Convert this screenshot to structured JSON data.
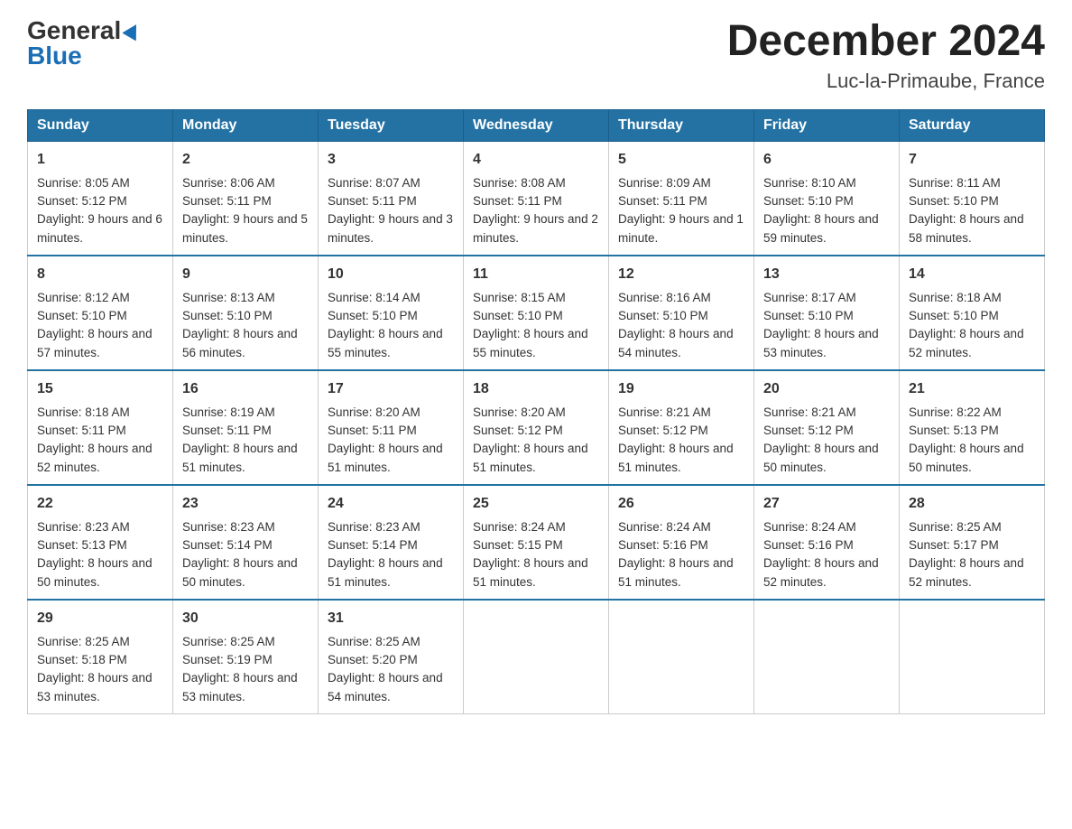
{
  "header": {
    "logo_general": "General",
    "logo_blue": "Blue",
    "month_title": "December 2024",
    "location": "Luc-la-Primaube, France"
  },
  "days_of_week": [
    "Sunday",
    "Monday",
    "Tuesday",
    "Wednesday",
    "Thursday",
    "Friday",
    "Saturday"
  ],
  "weeks": [
    [
      {
        "day": "1",
        "sunrise": "8:05 AM",
        "sunset": "5:12 PM",
        "daylight": "9 hours and 6 minutes."
      },
      {
        "day": "2",
        "sunrise": "8:06 AM",
        "sunset": "5:11 PM",
        "daylight": "9 hours and 5 minutes."
      },
      {
        "day": "3",
        "sunrise": "8:07 AM",
        "sunset": "5:11 PM",
        "daylight": "9 hours and 3 minutes."
      },
      {
        "day": "4",
        "sunrise": "8:08 AM",
        "sunset": "5:11 PM",
        "daylight": "9 hours and 2 minutes."
      },
      {
        "day": "5",
        "sunrise": "8:09 AM",
        "sunset": "5:11 PM",
        "daylight": "9 hours and 1 minute."
      },
      {
        "day": "6",
        "sunrise": "8:10 AM",
        "sunset": "5:10 PM",
        "daylight": "8 hours and 59 minutes."
      },
      {
        "day": "7",
        "sunrise": "8:11 AM",
        "sunset": "5:10 PM",
        "daylight": "8 hours and 58 minutes."
      }
    ],
    [
      {
        "day": "8",
        "sunrise": "8:12 AM",
        "sunset": "5:10 PM",
        "daylight": "8 hours and 57 minutes."
      },
      {
        "day": "9",
        "sunrise": "8:13 AM",
        "sunset": "5:10 PM",
        "daylight": "8 hours and 56 minutes."
      },
      {
        "day": "10",
        "sunrise": "8:14 AM",
        "sunset": "5:10 PM",
        "daylight": "8 hours and 55 minutes."
      },
      {
        "day": "11",
        "sunrise": "8:15 AM",
        "sunset": "5:10 PM",
        "daylight": "8 hours and 55 minutes."
      },
      {
        "day": "12",
        "sunrise": "8:16 AM",
        "sunset": "5:10 PM",
        "daylight": "8 hours and 54 minutes."
      },
      {
        "day": "13",
        "sunrise": "8:17 AM",
        "sunset": "5:10 PM",
        "daylight": "8 hours and 53 minutes."
      },
      {
        "day": "14",
        "sunrise": "8:18 AM",
        "sunset": "5:10 PM",
        "daylight": "8 hours and 52 minutes."
      }
    ],
    [
      {
        "day": "15",
        "sunrise": "8:18 AM",
        "sunset": "5:11 PM",
        "daylight": "8 hours and 52 minutes."
      },
      {
        "day": "16",
        "sunrise": "8:19 AM",
        "sunset": "5:11 PM",
        "daylight": "8 hours and 51 minutes."
      },
      {
        "day": "17",
        "sunrise": "8:20 AM",
        "sunset": "5:11 PM",
        "daylight": "8 hours and 51 minutes."
      },
      {
        "day": "18",
        "sunrise": "8:20 AM",
        "sunset": "5:12 PM",
        "daylight": "8 hours and 51 minutes."
      },
      {
        "day": "19",
        "sunrise": "8:21 AM",
        "sunset": "5:12 PM",
        "daylight": "8 hours and 51 minutes."
      },
      {
        "day": "20",
        "sunrise": "8:21 AM",
        "sunset": "5:12 PM",
        "daylight": "8 hours and 50 minutes."
      },
      {
        "day": "21",
        "sunrise": "8:22 AM",
        "sunset": "5:13 PM",
        "daylight": "8 hours and 50 minutes."
      }
    ],
    [
      {
        "day": "22",
        "sunrise": "8:23 AM",
        "sunset": "5:13 PM",
        "daylight": "8 hours and 50 minutes."
      },
      {
        "day": "23",
        "sunrise": "8:23 AM",
        "sunset": "5:14 PM",
        "daylight": "8 hours and 50 minutes."
      },
      {
        "day": "24",
        "sunrise": "8:23 AM",
        "sunset": "5:14 PM",
        "daylight": "8 hours and 51 minutes."
      },
      {
        "day": "25",
        "sunrise": "8:24 AM",
        "sunset": "5:15 PM",
        "daylight": "8 hours and 51 minutes."
      },
      {
        "day": "26",
        "sunrise": "8:24 AM",
        "sunset": "5:16 PM",
        "daylight": "8 hours and 51 minutes."
      },
      {
        "day": "27",
        "sunrise": "8:24 AM",
        "sunset": "5:16 PM",
        "daylight": "8 hours and 52 minutes."
      },
      {
        "day": "28",
        "sunrise": "8:25 AM",
        "sunset": "5:17 PM",
        "daylight": "8 hours and 52 minutes."
      }
    ],
    [
      {
        "day": "29",
        "sunrise": "8:25 AM",
        "sunset": "5:18 PM",
        "daylight": "8 hours and 53 minutes."
      },
      {
        "day": "30",
        "sunrise": "8:25 AM",
        "sunset": "5:19 PM",
        "daylight": "8 hours and 53 minutes."
      },
      {
        "day": "31",
        "sunrise": "8:25 AM",
        "sunset": "5:20 PM",
        "daylight": "8 hours and 54 minutes."
      },
      null,
      null,
      null,
      null
    ]
  ],
  "labels": {
    "sunrise": "Sunrise:",
    "sunset": "Sunset:",
    "daylight": "Daylight:"
  }
}
